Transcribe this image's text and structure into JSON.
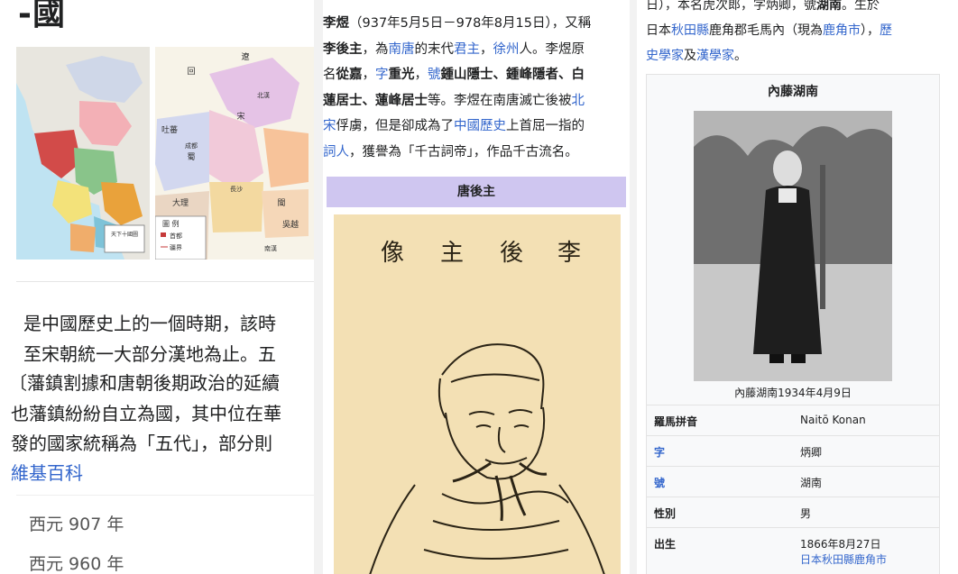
{
  "colA": {
    "title": "-國",
    "maps": {
      "map1_legend": "天下十國圖",
      "map2_labels": [
        "回",
        "遼",
        "吐蕃",
        "南漢",
        "成都",
        "北漢",
        "宋",
        "蜀",
        "長沙",
        "吳越",
        "大理",
        "閩"
      ],
      "map2_legend_title": "圖 例",
      "map2_legend_items": [
        "首都",
        "疆界"
      ]
    },
    "lines": [
      "是中國歷史上的一個時期，該時",
      "至宋朝統一大部分漢地為止。五",
      "〔藩鎮割據和唐朝後期政治的延續",
      "也藩鎮紛紛自立為國，其中位在華",
      "發的國家統稱為「五代」，部分則"
    ],
    "source": "維基百科",
    "stats": [
      "西元 907 年",
      "西元 960 年"
    ]
  },
  "colB": {
    "line1": {
      "t1": "李煜",
      "t2": "（937年5月5日－978年8月15日），又稱"
    },
    "line2": {
      "t1": "李後主",
      "t2": "，為",
      "l1": "南唐",
      "t3": "的末代",
      "l2": "君主",
      "t4": "，",
      "l3": "徐州",
      "t5": "人。李煜原"
    },
    "line3": {
      "t1": "名",
      "b1": "從嘉",
      "t2": "，",
      "l1": "字",
      "b2": "重光",
      "t3": "，",
      "l2": "號",
      "b3": "鍾山隱士、鍾峰隱者、白"
    },
    "line4": {
      "b1": "蓮居士、蓮峰居士",
      "t1": "等。李煜在南唐滅亡後被",
      "l1": "北"
    },
    "line5": {
      "l1": "宋",
      "t1": "俘虜，但是卻成為了",
      "l2": "中國歷史",
      "t2": "上首屈一指的"
    },
    "line6": {
      "l1": "詞人",
      "t1": "，獲譽為「千古詞帝」，作品千古流名。"
    },
    "caption": "唐後主",
    "portrait_inscription": [
      "像",
      "主",
      "後",
      "李"
    ]
  },
  "colC": {
    "top1": {
      "t1": "日），本名虎次郎，字炳卿，號",
      "b1": "湖南",
      "t2": "。生於"
    },
    "top2": {
      "t1": "日本",
      "l1": "秋田縣",
      "t2": "鹿角郡毛馬內（現為",
      "l2": "鹿角市",
      "t3": "），",
      "l3": "歷"
    },
    "top3": {
      "l1": "史學家",
      "t1": "及",
      "l2": "漢學家",
      "t2": "。"
    },
    "infobox": {
      "title": "內藤湖南",
      "photo_caption": "內藤湖南1934年4月9日",
      "rows": [
        {
          "key": "羅馬拼音",
          "value": "Naitō Konan",
          "link": false
        },
        {
          "key": "字",
          "value": "炳卿",
          "link": true
        },
        {
          "key": "號",
          "value": "湖南",
          "link": true
        },
        {
          "key": "性別",
          "value": "男",
          "link": false
        },
        {
          "key": "出生",
          "value": "1866年8月27日",
          "link": false,
          "value2": "日本秋田縣鹿角市"
        }
      ]
    }
  }
}
